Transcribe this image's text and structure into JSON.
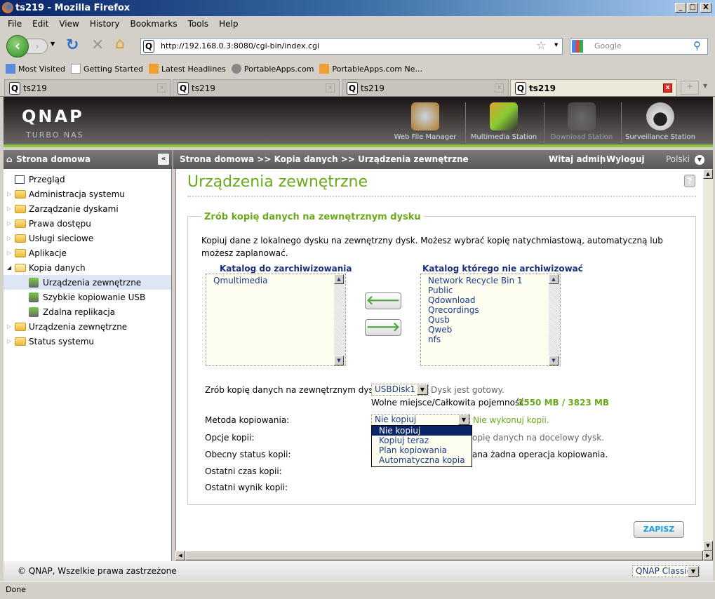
{
  "window": {
    "title": "ts219 - Mozilla Firefox",
    "controls": [
      "_",
      "□",
      "X"
    ]
  },
  "menu": [
    "File",
    "Edit",
    "View",
    "History",
    "Bookmarks",
    "Tools",
    "Help"
  ],
  "nav": {
    "url": "http://192.168.0.3:8080/cgi-bin/index.cgi",
    "search_placeholder": "Google"
  },
  "bookmarks": [
    "Most Visited",
    "Getting Started",
    "Latest Headlines",
    "PortableApps.com",
    "PortableApps.com Ne..."
  ],
  "tabs": [
    {
      "label": "ts219"
    },
    {
      "label": "ts219"
    },
    {
      "label": "ts219"
    },
    {
      "label": "ts219",
      "active": true
    }
  ],
  "header": {
    "logo": "QNAP",
    "tagline": "Turbo NAS",
    "apps": [
      "Web File Manager",
      "Multimedia Station",
      "Download Station",
      "Surveillance Station"
    ]
  },
  "subheader": {
    "home": "Strona domowa",
    "breadcrumb": "Strona domowa >> Kopia danych >> Urządzenia zewnętrzne",
    "welcome": "Witaj admin",
    "logout": "Wyloguj",
    "separator": "|",
    "language": "Polski"
  },
  "sidebar": {
    "items": [
      {
        "label": "Przegląd",
        "type": "page"
      },
      {
        "label": "Administracja systemu",
        "type": "folder"
      },
      {
        "label": "Zarządzanie dyskami",
        "type": "folder"
      },
      {
        "label": "Prawa dostępu",
        "type": "folder"
      },
      {
        "label": "Usługi sieciowe",
        "type": "folder"
      },
      {
        "label": "Aplikacje",
        "type": "folder"
      },
      {
        "label": "Kopia danych",
        "type": "folder-open"
      },
      {
        "label": "Urządzenia zewnętrzne",
        "type": "child",
        "selected": true
      },
      {
        "label": "Szybkie kopiowanie USB",
        "type": "child"
      },
      {
        "label": "Zdalna replikacja",
        "type": "child"
      },
      {
        "label": "Urządzenia zewnętrzne",
        "type": "folder"
      },
      {
        "label": "Status systemu",
        "type": "folder"
      }
    ]
  },
  "main": {
    "title": "Urządzenia zewnętrzne",
    "section_title": "Zrób kopię danych na zewnętrznym dysku",
    "description": "Kopiuj dane z lokalnego dysku na zewnętrzny dysk. Możesz wybrać kopię natychmiastową, automatyczną lub możesz zaplanować.",
    "include_header": "Katalog do zarchiwizowania",
    "include_list": [
      "Qmultimedia"
    ],
    "exclude_header": "Katalog którego nie archiwizować",
    "exclude_list": [
      "Network Recycle Bin 1",
      "Public",
      "Qdownload",
      "Qrecordings",
      "Qusb",
      "Qweb",
      "nfs"
    ],
    "disk_label": "Zrób kopię danych na zewnętrznym dysku:",
    "disk_value": "USBDisk1",
    "disk_status": "Dysk jest gotowy.",
    "space_label": "Wolne miejsce/Całkowita pojemność:",
    "space_value": "3550 MB / 3823 MB",
    "method_label": "Metoda kopiowania:",
    "method_value": "Nie kopiuj",
    "method_hint": "Nie wykonuj kopii.",
    "method_options": [
      "Nie kopiuj",
      "Kopiuj teraz",
      "Plan kopiowania",
      "Automatyczna kopia"
    ],
    "options_label": "Opcje kopii:",
    "options_text_visible": "opię danych na docelowy dysk.",
    "status_label": "Obecny status kopii:",
    "status_text_visible": "ana żadna operacja kopiowania.",
    "last_time_label": "Ostatni czas kopii:",
    "last_result_label": "Ostatni wynik kopii:",
    "save": "ZAPISZ"
  },
  "footer": {
    "copyright": "© QNAP, Wszelkie prawa zastrzeżone",
    "theme": "QNAP Classic"
  },
  "status": "Done",
  "colors": {
    "accent_green": "#6aaa1a",
    "header_dark": "#2a2424",
    "link_blue": "#1a3b8a",
    "selection": "#0a246a"
  }
}
